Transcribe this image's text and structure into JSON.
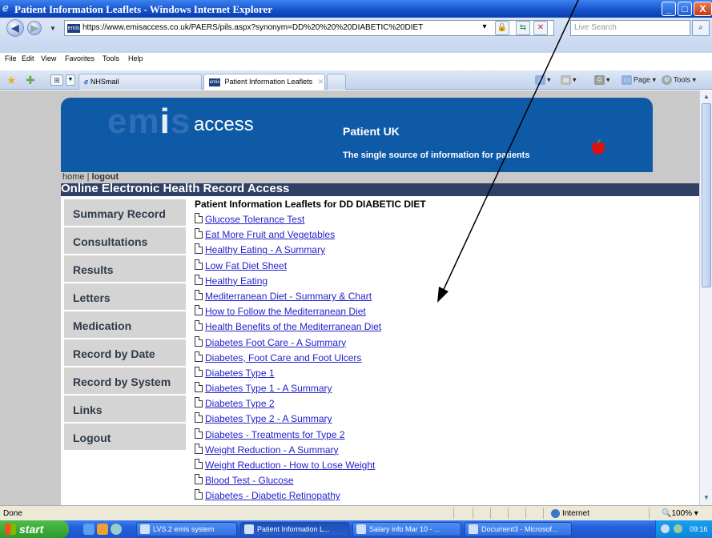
{
  "window": {
    "title": "Patient Information Leaflets - Windows Internet Explorer",
    "controls": [
      "_",
      "□",
      "X"
    ]
  },
  "address": {
    "url": "https://www.emisaccess.co.uk/PAERS/pils.aspx?synonym=DD%20%20%20DIABETIC%20DIET",
    "favicon_text": "emis",
    "search_placeholder": "Live Search"
  },
  "menubar": {
    "items": [
      "File",
      "Edit",
      "View",
      "Favorites",
      "Tools",
      "Help"
    ]
  },
  "tabs": {
    "items": [
      {
        "label": "NHSmail",
        "active": false
      },
      {
        "label": "Patient Information Leaflets",
        "active": true
      }
    ],
    "commands": [
      "Page",
      "Tools"
    ]
  },
  "site": {
    "logo_emis": "emis",
    "logo_access": "access",
    "title": "Patient UK",
    "subtitle": "The single source of information for patients",
    "toplinks": {
      "home": "home",
      "separator": "|",
      "logout": "logout"
    },
    "section_title": "Online Electronic Health Record Access"
  },
  "sidenav": {
    "items": [
      "Summary Record",
      "Consultations",
      "Results",
      "Letters",
      "Medication",
      "Record by Date",
      "Record by System",
      "Links",
      "Logout"
    ]
  },
  "leaflets": {
    "heading": "Patient Information Leaflets for DD DIABETIC DIET",
    "items": [
      "Glucose Tolerance Test",
      "Eat More Fruit and Vegetables",
      "Healthy Eating - A Summary",
      "Low Fat Diet Sheet",
      "Healthy Eating",
      "Mediterranean Diet - Summary & Chart",
      "How to Follow the Mediterranean Diet",
      "Health Benefits of the Mediterranean Diet",
      "Diabetes Foot Care - A Summary",
      "Diabetes, Foot Care and Foot Ulcers",
      "Diabetes Type 1",
      "Diabetes Type 1 - A Summary",
      "Diabetes Type 2",
      "Diabetes Type 2 - A Summary",
      "Diabetes - Treatments for Type 2",
      "Weight Reduction - A Summary",
      "Weight Reduction - How to Lose Weight",
      "Blood Test - Glucose",
      "Diabetes - Diabetic Retinopathy"
    ]
  },
  "status": {
    "text": "Done",
    "zone": "Internet",
    "zoom": "100%"
  },
  "taskbar": {
    "start": "start",
    "tasks": [
      "LVS.2 emis system",
      "Patient Information L...",
      "Salary info Mar 10 - ...",
      "Document3 - Microsof..."
    ],
    "clock": "09:16"
  }
}
